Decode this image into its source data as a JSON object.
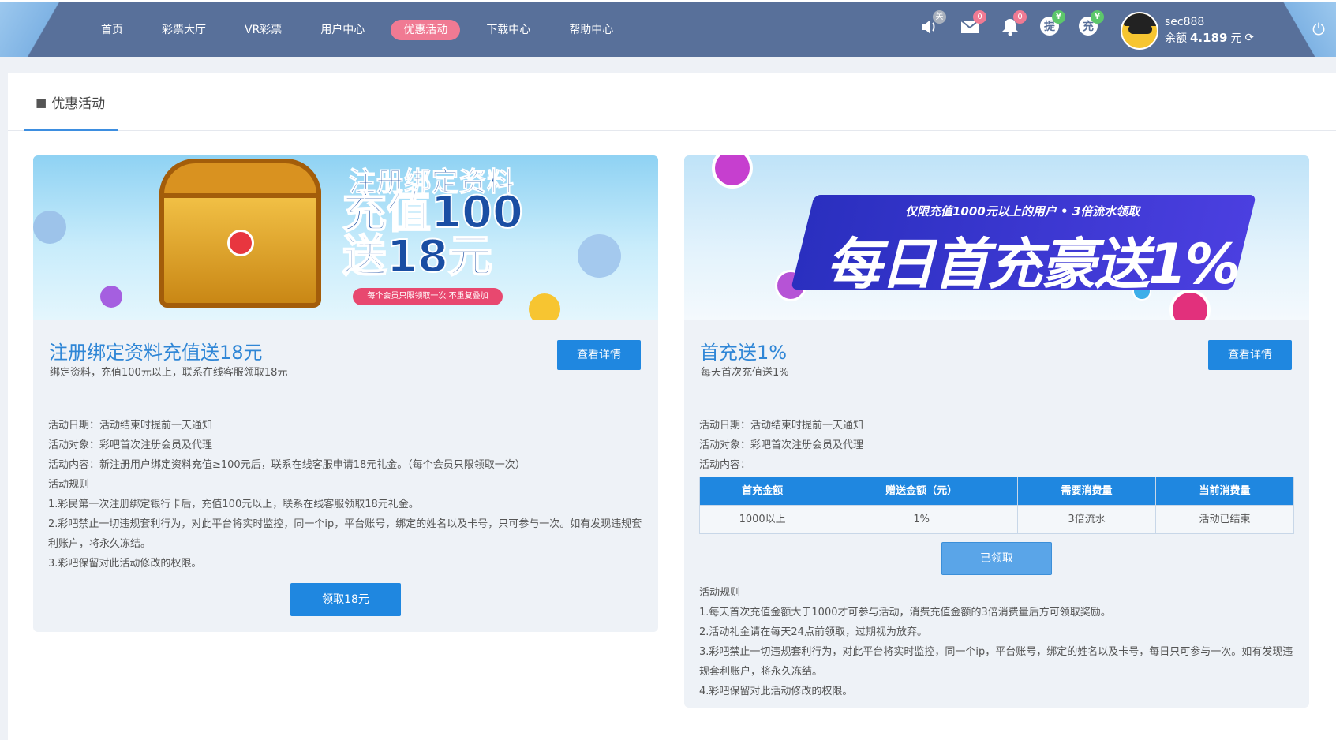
{
  "nav": {
    "items": [
      "首页",
      "彩票大厅",
      "VR彩票",
      "用户中心",
      "优惠活动",
      "下载中心",
      "帮助中心"
    ],
    "active_index": 4
  },
  "toolbar": {
    "sound_badge": "关",
    "mail_badge": "0",
    "bell_badge": "0",
    "withdraw_label": "提",
    "withdraw_badge": "¥",
    "deposit_label": "充",
    "deposit_badge": "¥"
  },
  "user": {
    "name": "sec888",
    "balance_label": "余额",
    "balance_value": "4.189",
    "currency": "元"
  },
  "page": {
    "title": "优惠活动"
  },
  "cards": [
    {
      "banner": {
        "line1": "注册绑定资料",
        "line2": "充值100",
        "line3": "送18元",
        "pill": "每个会员只限领取一次  不重复叠加"
      },
      "title": "注册绑定资料充值送18元",
      "subtitle": "绑定资料，充值100元以上，联系在线客服领取18元",
      "detail_button": "查看详情",
      "lines": [
        "活动日期：活动结束时提前一天通知",
        "活动对象：彩吧首次注册会员及代理",
        "活动内容：新注册用户绑定资料充值≥100元后，联系在线客服申请18元礼金。（每个会员只限领取一次）",
        "活动规则",
        "1.彩民第一次注册绑定银行卡后，充值100元以上，联系在线客服领取18元礼金。",
        "2.彩吧禁止一切违规套利行为，对此平台将实时监控，同一个ip，平台账号，绑定的姓名以及卡号，只可参与一次。如有发现违规套利账户，将永久冻结。",
        "3.彩吧保留对此活动修改的权限。"
      ],
      "action_button": "领取18元"
    },
    {
      "banner": {
        "sub": "仅限充值1000元以上的用户 • 3倍流水领取",
        "main": "每日首充豪送1%"
      },
      "title": "首充送1%",
      "subtitle": "每天首次充值送1%",
      "detail_button": "查看详情",
      "lines_top": [
        "活动日期：活动结束时提前一天通知",
        "活动对象：彩吧首次注册会员及代理",
        "活动内容："
      ],
      "table": {
        "headers": [
          "首充金额",
          "赠送金额（元）",
          "需要消费量",
          "当前消费量"
        ],
        "row": [
          "1000以上",
          "1%",
          "3倍流水",
          "活动已结束"
        ]
      },
      "action_button": "已领取",
      "lines_bottom": [
        "活动规则",
        "1.每天首次充值金额大于1000才可参与活动，消费充值金额的3倍消费量后方可领取奖励。",
        "2.活动礼金请在每天24点前领取，过期视为放弃。",
        "3.彩吧禁止一切违规套利行为，对此平台将实时监控，同一个ip，平台账号，绑定的姓名以及卡号，每日只可参与一次。如有发现违规套利账户，将永久冻结。",
        "4.彩吧保留对此活动修改的权限。"
      ]
    }
  ]
}
